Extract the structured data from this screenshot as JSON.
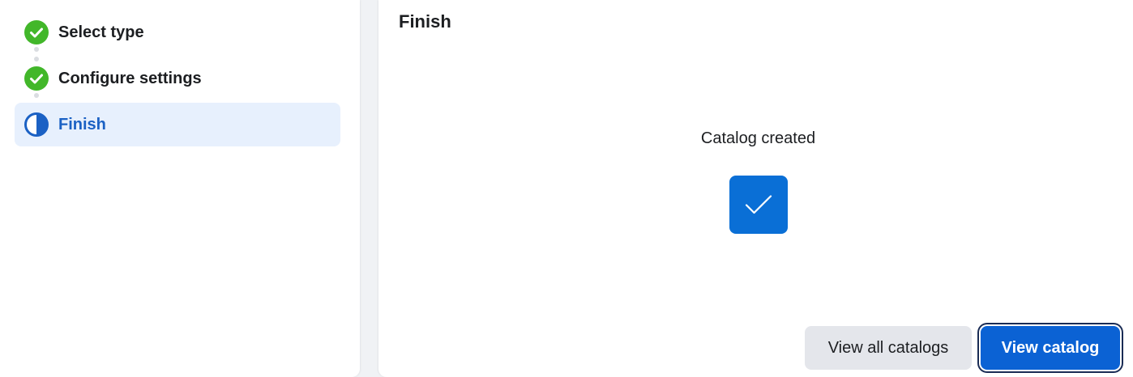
{
  "wizard": {
    "steps": [
      {
        "label": "Select type",
        "status": "complete",
        "icon": "check-circle-icon"
      },
      {
        "label": "Configure settings",
        "status": "complete",
        "icon": "check-circle-icon"
      },
      {
        "label": "Finish",
        "status": "in-progress",
        "icon": "half-circle-icon"
      }
    ]
  },
  "main": {
    "title": "Finish",
    "status_text": "Catalog created",
    "status_icon": "checkmark-icon"
  },
  "actions": {
    "secondary_label": "View all catalogs",
    "primary_label": "View catalog"
  },
  "colors": {
    "complete_green": "#42b72a",
    "accent_blue": "#0a6fd6",
    "active_bg": "#e7f0fd",
    "active_text": "#1b61c4"
  }
}
